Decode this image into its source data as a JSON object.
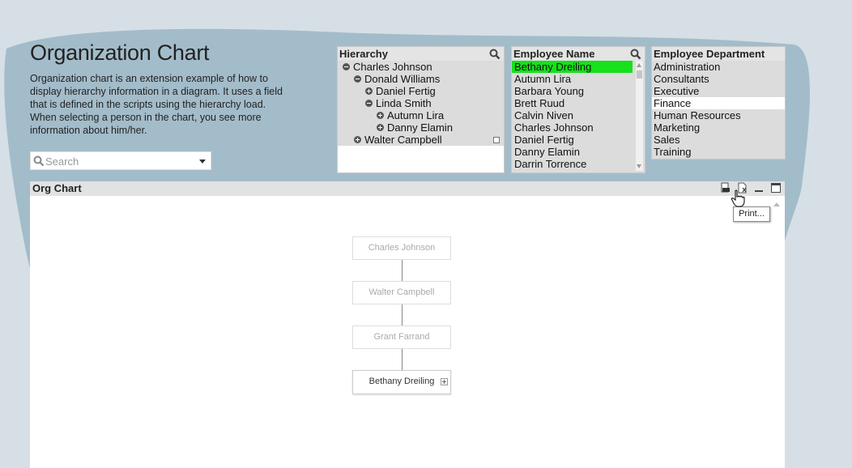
{
  "page": {
    "title": "Organization Chart",
    "description": "Organization chart is an extension example of how to display hierarchy information in a diagram.  It uses a field that is defined in the scripts using the hierarchy load.  When selecting a person in the chart, you see more information about him/her."
  },
  "search": {
    "placeholder": "Search",
    "icon": "search-icon"
  },
  "hierarchy": {
    "title": "Hierarchy",
    "items": [
      {
        "label": "Charles Johnson",
        "toggle": "minus"
      },
      {
        "label": "Donald Williams",
        "toggle": "minus"
      },
      {
        "label": "Daniel Fertig",
        "toggle": "plus"
      },
      {
        "label": "Linda Smith",
        "toggle": "minus"
      },
      {
        "label": "Autumn Lira",
        "toggle": "plus"
      },
      {
        "label": "Danny Elamin",
        "toggle": "plus"
      },
      {
        "label": "Walter Campbell",
        "toggle": "plus"
      }
    ]
  },
  "employee_name": {
    "title": "Employee Name",
    "selected": "Bethany Dreiling",
    "items": [
      "Bethany Dreiling",
      "Autumn Lira",
      "Barbara Young",
      "Brett Ruud",
      "Calvin Niven",
      "Charles Johnson",
      "Daniel Fertig",
      "Danny Elamin",
      "Darrin Torrence"
    ]
  },
  "employee_department": {
    "title": "Employee Department",
    "selected": "Finance",
    "items": [
      "Administration",
      "Consultants",
      "Executive",
      "Finance",
      "Human Resources",
      "Marketing",
      "Sales",
      "Training"
    ]
  },
  "org_chart": {
    "title": "Org Chart",
    "tooltip": "Print...",
    "icons": [
      "print-icon",
      "export-excel-icon",
      "minimize-icon",
      "maximize-icon"
    ],
    "nodes": [
      {
        "name": "Charles Johnson",
        "active": false
      },
      {
        "name": "Walter Campbell",
        "active": false
      },
      {
        "name": "Grant Farrand",
        "active": false
      },
      {
        "name": "Bethany Dreiling",
        "active": true
      }
    ]
  },
  "colors": {
    "selection_green": "#17e01c",
    "background_blue": "#a5bfcc"
  }
}
